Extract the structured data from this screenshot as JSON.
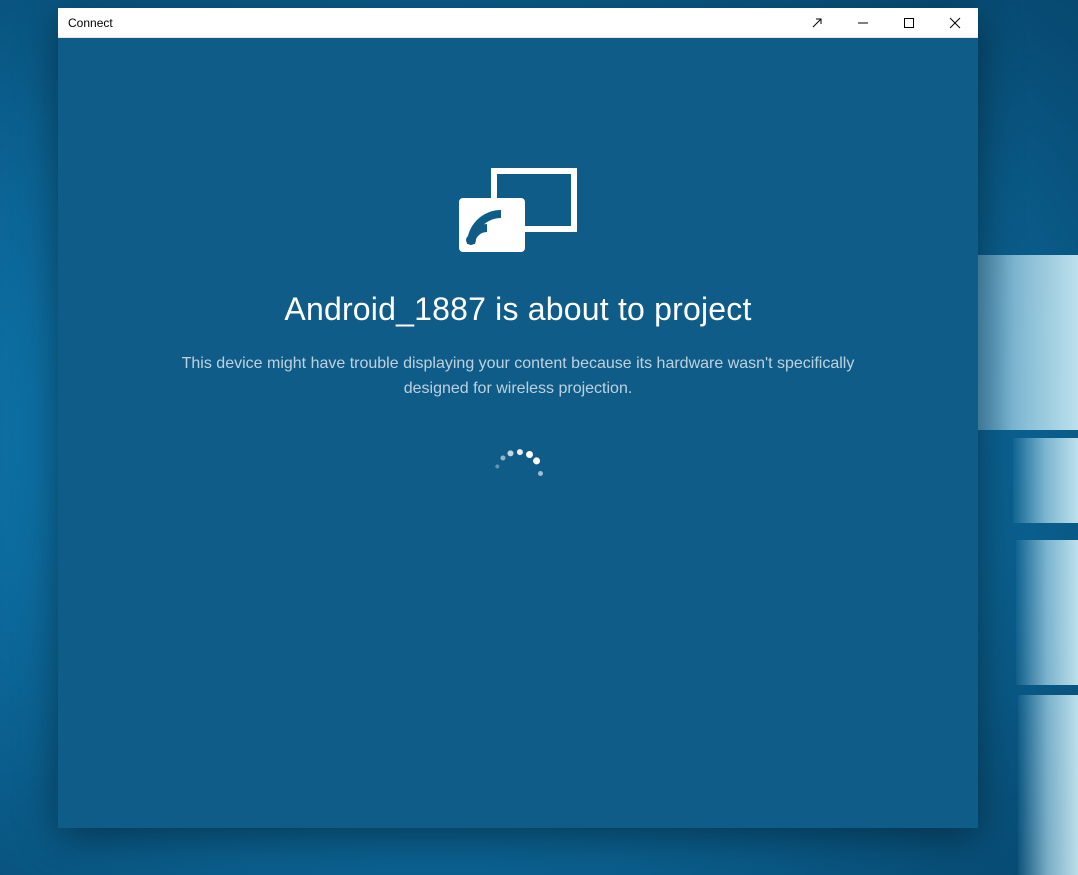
{
  "window": {
    "title": "Connect"
  },
  "main": {
    "headline": "Android_1887 is about to project",
    "subtext": "This device might have trouble displaying your content because its hardware wasn't specifically designed for wireless projection."
  }
}
